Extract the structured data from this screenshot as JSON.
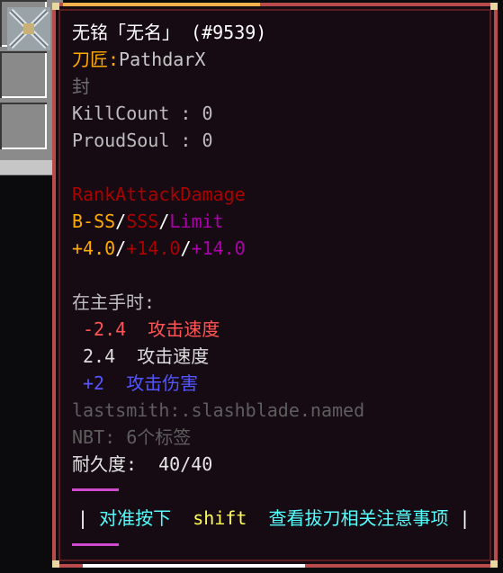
{
  "colors": {
    "white": "#ffffff",
    "gray": "#7d7d7d",
    "gold": "#ffaa00",
    "dark_red": "#aa0000",
    "purple": "#aa00aa",
    "red": "#ff5555",
    "blue": "#5555ff",
    "aqua": "#55ffff",
    "yellow": "#ffff55",
    "light": "#e6e6e6"
  },
  "tooltip": {
    "title": "无铭「无名」 (#9539)",
    "smith_label": "刀匠:",
    "smith_name": "PathdarX",
    "sealed": "封",
    "killcount": "KillCount : 0",
    "proudsoul": "ProudSoul : 0",
    "rank_title": "RankAttackDamage",
    "rank_b": "B-SS",
    "rank_sep1": "/",
    "rank_sss": "SSS",
    "rank_sep2": "/",
    "rank_limit": "Limit",
    "dmg_b": "+4.0",
    "dmg_sep1": "/",
    "dmg_sss": "+14.0",
    "dmg_sep2": "/",
    "dmg_limit": "+14.0",
    "mainhand_header": "在主手时:",
    "attr1_value": "-2.4",
    "attr1_name": "攻击速度",
    "attr2_value": "2.4",
    "attr2_name": "攻击速度",
    "attr3_value": "+2",
    "attr3_name": "攻击伤害",
    "registry_name": "lastsmith:.slashblade.named",
    "nbt": "NBT: 6个标签",
    "durability_label": "耐久度:",
    "durability_value": "40/40",
    "hint_bar_left": "|",
    "hint_pre": "对准按下",
    "hint_key": "shift",
    "hint_post": "查看拔刀相关注意事项",
    "hint_bar_right": "|"
  }
}
